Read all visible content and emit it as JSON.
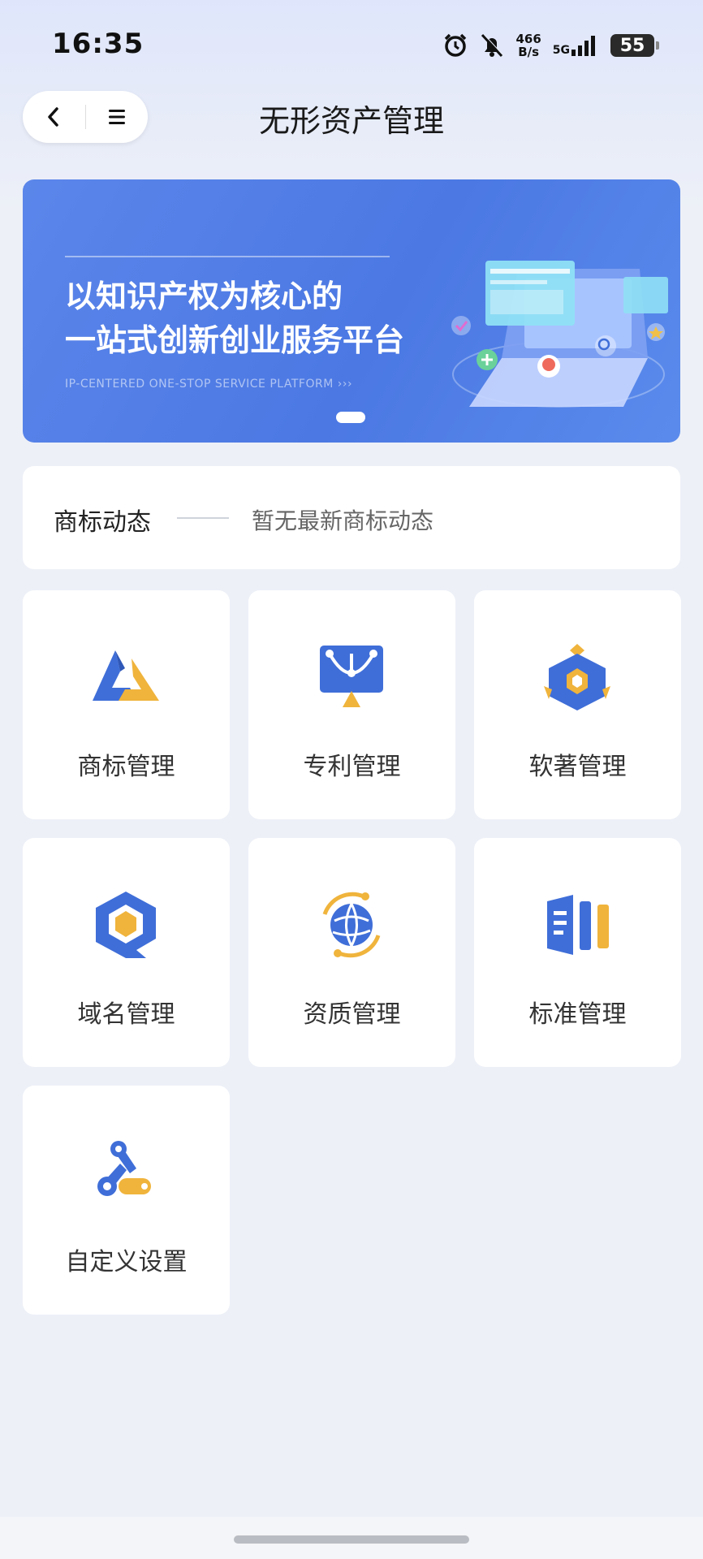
{
  "status_bar": {
    "time": "16:35",
    "net_speed_value": "466",
    "net_speed_unit": "B/s",
    "network": "5G",
    "battery": "55",
    "icons": [
      "alarm-icon",
      "bell-off-icon",
      "signal-icon",
      "battery-icon"
    ]
  },
  "nav": {
    "title": "无形资产管理",
    "back_icon": "chevron-left-icon",
    "menu_icon": "menu-icon"
  },
  "banner": {
    "line1": "以知识产权为核心的",
    "line2": "一站式创新创业服务平台",
    "subtitle": "IP-CENTERED ONE-STOP SERVICE PLATFORM  ›››",
    "colors": {
      "bg": "#4b78e3",
      "accent": "#f0b43c"
    }
  },
  "news": {
    "label": "商标动态",
    "text": "暂无最新商标动态"
  },
  "tiles": [
    {
      "label": "商标管理",
      "icon": "trademark-icon"
    },
    {
      "label": "专利管理",
      "icon": "patent-icon"
    },
    {
      "label": "软著管理",
      "icon": "software-copyright-icon"
    },
    {
      "label": "域名管理",
      "icon": "domain-icon"
    },
    {
      "label": "资质管理",
      "icon": "qualification-icon"
    },
    {
      "label": "标准管理",
      "icon": "standard-icon"
    },
    {
      "label": "自定义设置",
      "icon": "custom-settings-icon"
    }
  ],
  "theme": {
    "blue": "#3f6ed8",
    "yellow": "#f0b43c",
    "page_bg": "#edf0f7"
  }
}
